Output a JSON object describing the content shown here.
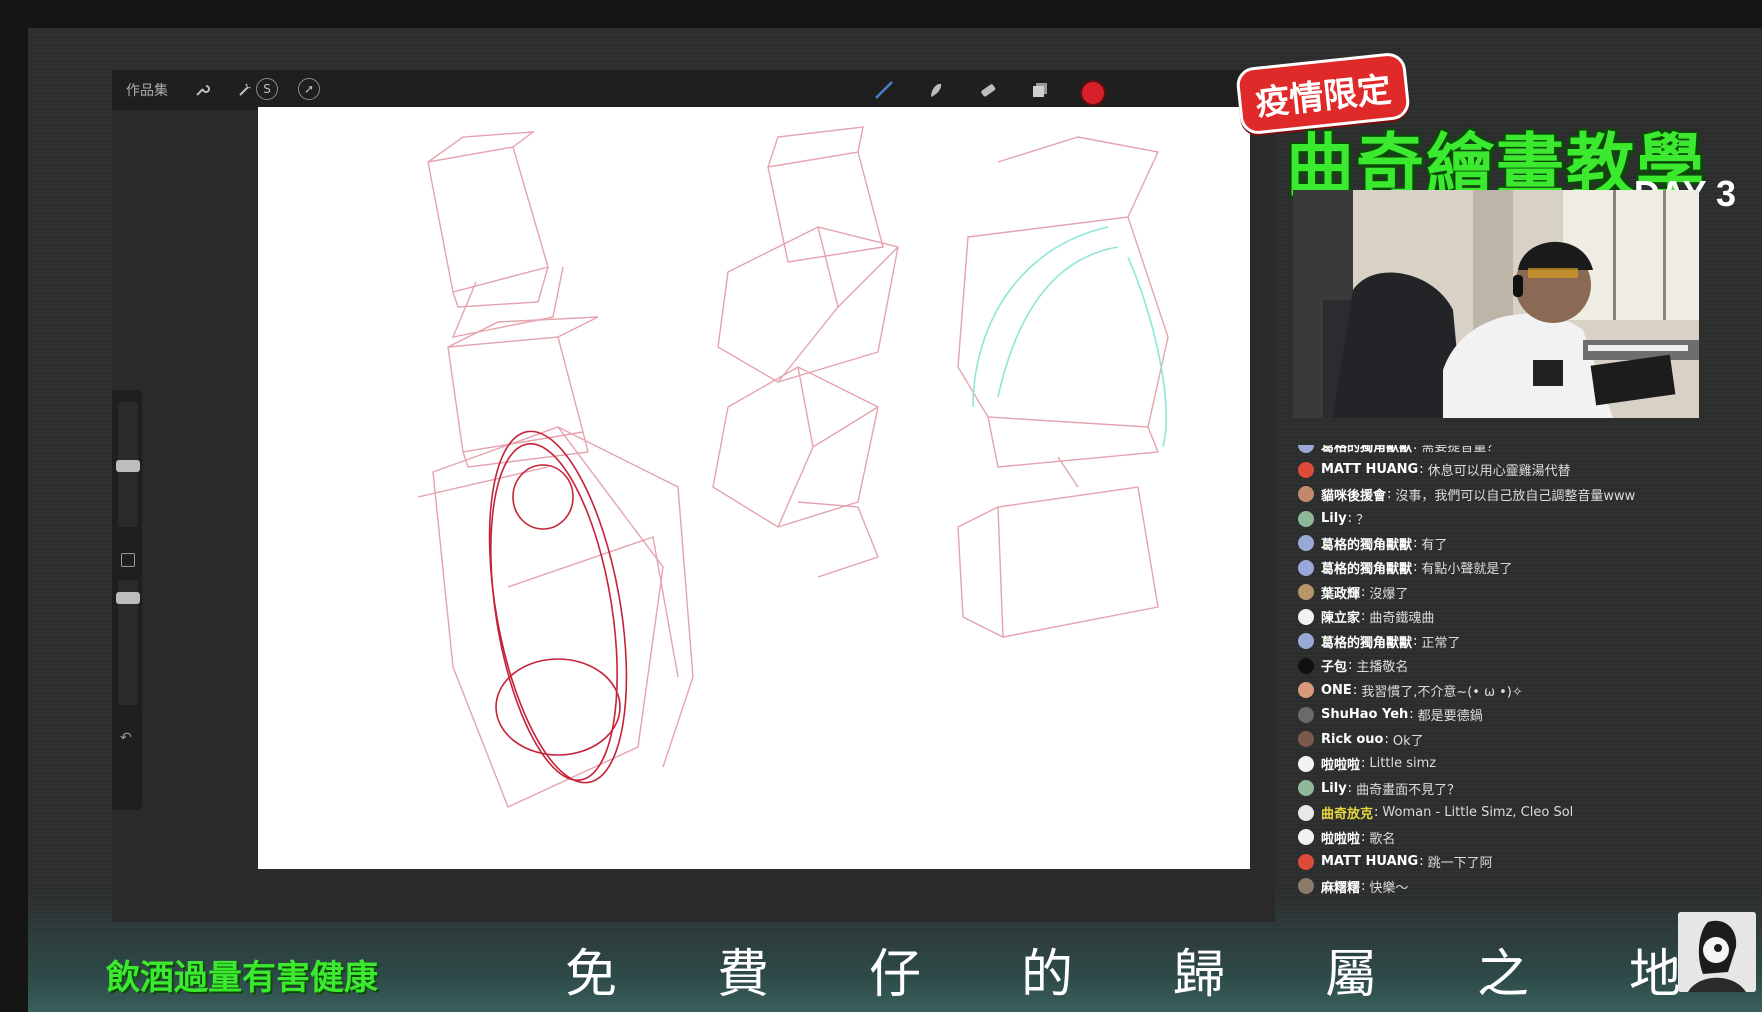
{
  "app": {
    "gallery_label": "作品集",
    "icons_left": [
      "wrench-icon",
      "magic-wand-icon",
      "selection-icon",
      "transform-arrow-icon"
    ],
    "icons_right": [
      "brush-icon",
      "smudge-icon",
      "eraser-icon",
      "layers-icon"
    ],
    "current_color": "#d8202a"
  },
  "promo": {
    "badge": "疫情限定",
    "title": "曲奇繪畫教學",
    "day": "DAY 3"
  },
  "chat": [
    {
      "name": "葛格的獨角獸獸",
      "msg": "需要提音量？",
      "avatar": "#9aa8d8",
      "highlight": false
    },
    {
      "name": "MATT HUANG",
      "msg": "休息可以用心靈雞湯代替",
      "avatar": "#e04a3a",
      "highlight": false
    },
    {
      "name": "貓咪後援會",
      "msg": "沒事，我們可以自己放自己調整音量www",
      "avatar": "#c28a6a",
      "highlight": false
    },
    {
      "name": "Lily",
      "msg": "？",
      "avatar": "#8fb89a",
      "highlight": false
    },
    {
      "name": "葛格的獨角獸獸",
      "msg": "有了",
      "avatar": "#9aa8d8",
      "highlight": false
    },
    {
      "name": "葛格的獨角獸獸",
      "msg": "有點小聲就是了",
      "avatar": "#9aa8d8",
      "highlight": false
    },
    {
      "name": "葉政輝",
      "msg": "沒爆了",
      "avatar": "#b8966a",
      "highlight": false
    },
    {
      "name": "陳立家",
      "msg": "曲奇鐵魂曲",
      "avatar": "#f2f2f2",
      "highlight": false
    },
    {
      "name": "葛格的獨角獸獸",
      "msg": "正常了",
      "avatar": "#9aa8d8",
      "highlight": false
    },
    {
      "name": "子包",
      "msg": "主播敬名",
      "avatar": "#111111",
      "highlight": false
    },
    {
      "name": "ONE",
      "msg": "我習慣了,不介意~(• ω •)✧",
      "avatar": "#d89a7a",
      "highlight": false
    },
    {
      "name": "ShuHao Yeh",
      "msg": "都是要德鍋",
      "avatar": "#6a6a6a",
      "highlight": false
    },
    {
      "name": "Rick ouo",
      "msg": "Ok了",
      "avatar": "#7a5a4a",
      "highlight": false
    },
    {
      "name": "啦啦啦",
      "msg": "Little simz",
      "avatar": "#f2f2f2",
      "highlight": false
    },
    {
      "name": "Lily",
      "msg": "曲奇畫面不見了？",
      "avatar": "#8fb89a",
      "highlight": false
    },
    {
      "name": "曲奇放克",
      "msg": "Woman - Little Simz, Cleo Sol",
      "avatar": "#e8e8e8",
      "highlight": true
    },
    {
      "name": "啦啦啦",
      "msg": "歌名",
      "avatar": "#f2f2f2",
      "highlight": false
    },
    {
      "name": "MATT HUANG",
      "msg": "跳一下了阿",
      "avatar": "#e04a3a",
      "highlight": false
    },
    {
      "name": "麻糬糬",
      "msg": "快樂～",
      "avatar": "#8a7a6a",
      "highlight": false
    }
  ],
  "footer": {
    "warning": "飲酒過量有害健康",
    "ticker": [
      "免",
      "費",
      "仔",
      "的",
      "歸",
      "屬",
      "之",
      "地"
    ]
  },
  "colors": {
    "promo_green": "#3bea2f",
    "badge_red": "#e02a2a",
    "chat_highlight": "#e8d640"
  }
}
